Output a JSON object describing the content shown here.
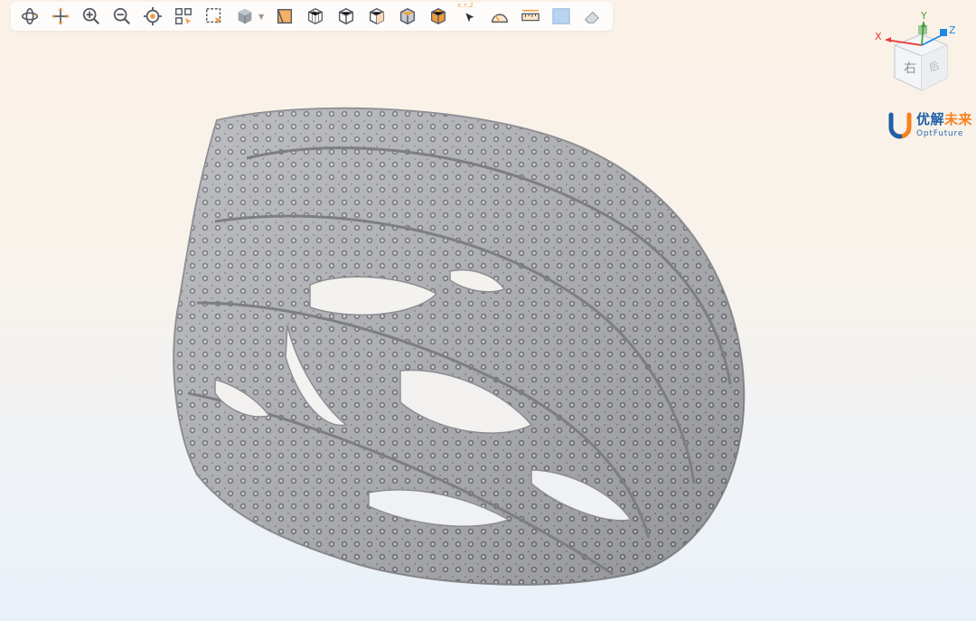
{
  "toolbar": {
    "tools": [
      {
        "name": "rotate-icon",
        "label": "Rotate"
      },
      {
        "name": "pan-icon",
        "label": "Pan"
      },
      {
        "name": "zoom-in-icon",
        "label": "Zoom In"
      },
      {
        "name": "zoom-out-icon",
        "label": "Zoom Out"
      },
      {
        "name": "fit-view-icon",
        "label": "Fit View"
      },
      {
        "name": "select-all-icon",
        "label": "Select All"
      },
      {
        "name": "box-select-icon",
        "label": "Box Select"
      },
      {
        "name": "render-mode-icon",
        "label": "Render Mode"
      },
      {
        "name": "section-view-icon",
        "label": "Section"
      },
      {
        "name": "wireframe-cube-icon",
        "label": "Wireframe"
      },
      {
        "name": "view-front-icon",
        "label": "Front View"
      },
      {
        "name": "view-side-icon",
        "label": "Side View"
      },
      {
        "name": "view-top-icon",
        "label": "Top View"
      },
      {
        "name": "view-iso-icon",
        "label": "Iso View"
      },
      {
        "name": "pick-point-icon",
        "label": "Pick Point"
      },
      {
        "name": "measure-angle-icon",
        "label": "Measure Angle"
      },
      {
        "name": "measure-distance-icon",
        "label": "Measure Distance"
      },
      {
        "name": "background-color-icon",
        "label": "Background"
      },
      {
        "name": "eraser-icon",
        "label": "Clear"
      }
    ],
    "pick_point_caption": "X,Y,Z"
  },
  "viewcube": {
    "axis_x": "X",
    "axis_y": "Y",
    "axis_z": "Z",
    "face_right": "右",
    "face_back": "后",
    "colors": {
      "x": "#e53935",
      "y": "#43a047",
      "z": "#1e88e5"
    }
  },
  "brand": {
    "cn_part1": "优解",
    "cn_part2": "未来",
    "en": "OptFuture",
    "colors": {
      "blue": "#1f5fa8",
      "orange": "#f58220"
    }
  },
  "colors": {
    "accent_orange": "#f39c3c",
    "icon_gray": "#555a63",
    "model_gray": "#a8a9ad"
  }
}
